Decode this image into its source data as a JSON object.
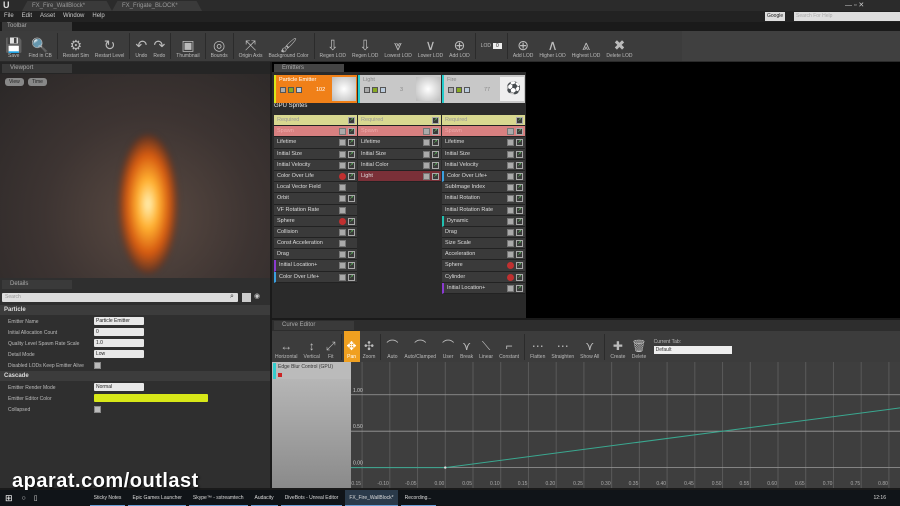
{
  "window": {
    "tabs": [
      "FX_Fire_WallBlock*",
      "FX_Frigate_BLOCK*"
    ],
    "menu": [
      "File",
      "Edit",
      "Asset",
      "Window",
      "Help"
    ],
    "help_search_provider": "Google",
    "help_search_placeholder": "Search For Help"
  },
  "toolbar": {
    "tab": "Toolbar",
    "buttons": [
      {
        "label": "Save",
        "icon": "save-icon",
        "glyph": "💾"
      },
      {
        "label": "Find in CB",
        "icon": "search-icon",
        "glyph": "🔍"
      },
      {
        "label": "Restart Sim",
        "icon": "gear-icon",
        "glyph": "⚙"
      },
      {
        "label": "Restart Level",
        "icon": "restart-icon",
        "glyph": "↻"
      },
      {
        "label": "Undo",
        "icon": "undo-icon",
        "glyph": "↶"
      },
      {
        "label": "Redo",
        "icon": "redo-icon",
        "glyph": "↷"
      },
      {
        "label": "Thumbnail",
        "icon": "thumbnail-icon",
        "glyph": "▣"
      },
      {
        "label": "Bounds",
        "icon": "bounds-icon",
        "glyph": "◎"
      },
      {
        "label": "Origin Axis",
        "icon": "axis-icon",
        "glyph": "⤧"
      },
      {
        "label": "Background Color",
        "icon": "brush-icon",
        "glyph": "🖌"
      },
      {
        "label": "Regen LOD",
        "icon": "regen-lod-icon",
        "glyph": "⇩"
      },
      {
        "label": "Regen LOD",
        "icon": "regen-lod-icon",
        "glyph": "⇩"
      },
      {
        "label": "Lowest LOD",
        "icon": "lowest-lod-icon",
        "glyph": "⩔"
      },
      {
        "label": "Lower LOD",
        "icon": "lower-lod-icon",
        "glyph": "∨"
      },
      {
        "label": "Add LOD",
        "icon": "add-lod-icon",
        "glyph": "⊕"
      }
    ],
    "lod_label": "LOD",
    "lod_value": "0",
    "buttons2": [
      {
        "label": "Add LOD",
        "icon": "add-lod-icon",
        "glyph": "⊕"
      },
      {
        "label": "Higher LOD",
        "icon": "higher-lod-icon",
        "glyph": "∧"
      },
      {
        "label": "Highest LOD",
        "icon": "highest-lod-icon",
        "glyph": "⩓"
      },
      {
        "label": "Delete LOD",
        "icon": "delete-icon",
        "glyph": "✖"
      }
    ]
  },
  "viewport": {
    "tab": "Viewport",
    "view": "View",
    "time": "Time"
  },
  "details": {
    "tab": "Details",
    "search_placeholder": "Search",
    "particle": {
      "title": "Particle",
      "rows": [
        {
          "label": "Emitter Name",
          "value": "Particle Emitter",
          "type": "text"
        },
        {
          "label": "Initial Allocation Count",
          "value": "0",
          "type": "num"
        },
        {
          "label": "Quality Level Spawn Rate Scale",
          "value": "1.0",
          "type": "num"
        },
        {
          "label": "Detail Mode",
          "value": "Low",
          "type": "select"
        },
        {
          "label": "Disabled LODs Keep Emitter Alive",
          "value": "",
          "type": "check"
        }
      ]
    },
    "cascade": {
      "title": "Cascade",
      "rows": [
        {
          "label": "Emitter Render Mode",
          "value": "Normal",
          "type": "select"
        },
        {
          "label": "Emitter Editor Color",
          "value": "",
          "type": "color"
        },
        {
          "label": "Collapsed",
          "value": "",
          "type": "check"
        }
      ]
    },
    "editor_color": "#d8e818"
  },
  "emitters": {
    "tab": "Emitters",
    "type_label": "GPU Sprites",
    "columns": [
      {
        "name": "Particle Emitter",
        "count": "102",
        "selected": true,
        "modules": [
          {
            "l": "Required",
            "k": "req"
          },
          {
            "l": "Spawn",
            "k": "spawn"
          },
          {
            "l": "Lifetime"
          },
          {
            "l": "Initial Size"
          },
          {
            "l": "Initial Velocity"
          },
          {
            "l": "Color Over Life",
            "x": true
          },
          {
            "l": "Local Vector Field",
            "ng": true
          },
          {
            "l": "Orbit"
          },
          {
            "l": "VF Rotation Rate",
            "ng": true
          },
          {
            "l": "Sphere",
            "x": true
          },
          {
            "l": "Collision"
          },
          {
            "l": "Const Acceleration",
            "ng": true
          },
          {
            "l": "Drag"
          },
          {
            "l": "Initial Location+",
            "a": "#8a3ad0"
          },
          {
            "l": "Color Over Life+",
            "a": "#3aa0e0"
          }
        ]
      },
      {
        "name": "Light",
        "count": "3",
        "modules": [
          {
            "l": "Required",
            "k": "req"
          },
          {
            "l": "Spawn",
            "k": "spawn"
          },
          {
            "l": "Lifetime"
          },
          {
            "l": "Initial Size"
          },
          {
            "l": "Initial Color"
          },
          {
            "l": "Light",
            "k": "light"
          }
        ]
      },
      {
        "name": "Fire",
        "count": "77",
        "modules": [
          {
            "l": "Required",
            "k": "req"
          },
          {
            "l": "Spawn",
            "k": "spawn"
          },
          {
            "l": "Lifetime"
          },
          {
            "l": "Initial Size"
          },
          {
            "l": "Initial Velocity"
          },
          {
            "l": "Color Over Life+",
            "a": "#3aa0e0"
          },
          {
            "l": "SubImage Index"
          },
          {
            "l": "Initial Rotation"
          },
          {
            "l": "Initial Rotation Rate"
          },
          {
            "l": "Dynamic",
            "a": "#20c0b0"
          },
          {
            "l": "Drag"
          },
          {
            "l": "Size Scale"
          },
          {
            "l": "Acceleration"
          },
          {
            "l": "Sphere",
            "x": true
          },
          {
            "l": "Cylinder",
            "x": true
          },
          {
            "l": "Initial Location+",
            "a": "#8a3ad0"
          }
        ]
      }
    ]
  },
  "curve_editor": {
    "tab": "Curve Editor",
    "buttons": [
      {
        "label": "Horizontal",
        "glyph": "↔",
        "icon": "fit-horizontal-icon"
      },
      {
        "label": "Vertical",
        "glyph": "↕",
        "icon": "fit-vertical-icon"
      },
      {
        "label": "Fit",
        "glyph": "⤢",
        "icon": "fit-icon"
      },
      {
        "label": "Pan",
        "glyph": "✥",
        "icon": "pan-icon",
        "active": true
      },
      {
        "label": "Zoom",
        "glyph": "✣",
        "icon": "zoom-icon"
      },
      {
        "label": "Auto",
        "glyph": "⌒",
        "icon": "auto-tangent-icon"
      },
      {
        "label": "Auto/Clamped",
        "glyph": "⌒",
        "icon": "auto-clamped-icon"
      },
      {
        "label": "User",
        "glyph": "⌒",
        "icon": "user-tangent-icon"
      },
      {
        "label": "Break",
        "glyph": "⋎",
        "icon": "break-tangent-icon"
      },
      {
        "label": "Linear",
        "glyph": "⟍",
        "icon": "linear-icon"
      },
      {
        "label": "Constant",
        "glyph": "⌐",
        "icon": "constant-icon"
      },
      {
        "label": "Flatten",
        "glyph": "⋯",
        "icon": "flatten-icon"
      },
      {
        "label": "Straighten",
        "glyph": "⋯",
        "icon": "straighten-icon"
      },
      {
        "label": "Show All",
        "glyph": "⋎",
        "icon": "show-all-icon"
      },
      {
        "label": "Create",
        "glyph": "✚",
        "icon": "create-tab-icon"
      },
      {
        "label": "Delete",
        "glyph": "🗑",
        "icon": "delete-tab-icon"
      }
    ],
    "current_tab_label": "Current Tab:",
    "current_tab_value": "Default",
    "track": "Edge Blur Control (GPU)"
  },
  "chart_data": {
    "type": "line",
    "xlim": [
      -0.17,
      0.82
    ],
    "ylim": [
      -0.28,
      1.45
    ],
    "x_ticks": [
      "-0.15",
      "-0.10",
      "-0.05",
      "0.00",
      "0.05",
      "0.10",
      "0.15",
      "0.20",
      "0.25",
      "0.30",
      "0.35",
      "0.40",
      "0.45",
      "0.50",
      "0.55",
      "0.60",
      "0.65",
      "0.70",
      "0.75",
      "0.80"
    ],
    "y_ticks": [
      "1.00",
      "0.50",
      "0.00"
    ],
    "series": [
      {
        "name": "Edge Blur Control (GPU)",
        "x": [
          -0.17,
          0.0,
          0.82
        ],
        "y": [
          0.0,
          0.0,
          0.82
        ],
        "color": "#3aa890"
      }
    ]
  },
  "watermark": "aparat.com/outlast",
  "taskbar": {
    "items": [
      "Sticky Notes",
      "Epic Games Launcher",
      "Skype™ - sstreamtech",
      "Audacity",
      "DiveBots - Unreal Editor",
      "FX_Fire_WallBlock*",
      "Recording..."
    ],
    "clock": "12:16"
  }
}
